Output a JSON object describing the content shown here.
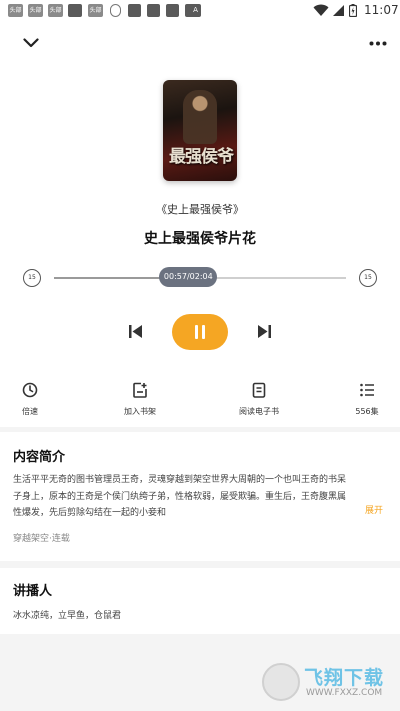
{
  "status_bar": {
    "time": "11:07",
    "notif_labels": [
      "头部",
      "头部",
      "头部",
      "头部"
    ],
    "a_label": "A"
  },
  "header": {
    "collapse_icon": "chevron-down-icon",
    "more_icon": "more-icon"
  },
  "cover": {
    "title_art": "最强侯爷"
  },
  "book_name": "《史上最强侯爷》",
  "episode_title": "史上最强侯爷片花",
  "player": {
    "time": "00:57/02:04",
    "progress": 0.46,
    "skip_back_label": "15",
    "skip_forward_label": "15"
  },
  "tools": [
    {
      "icon": "clock-icon",
      "label": "倍速"
    },
    {
      "icon": "add-shelf-icon",
      "label": "加入书架"
    },
    {
      "icon": "ebook-icon",
      "label": "阅读电子书"
    },
    {
      "icon": "list-icon",
      "label": "556集"
    }
  ],
  "intro": {
    "title": "内容简介",
    "line1": "生活平平无奇的图书管理员王奇，灵魂穿越到架空世界大周朝的一个也叫王奇的书呆",
    "line2": "子身上，原本的王奇是个侯门纨绔子弟，性格软弱，屡受欺骗。重生后，王奇腹黑属",
    "line3": "性爆发，先后剪除勾结在一起的小妾和",
    "expand": "展开",
    "tags": "穿越架空·连载"
  },
  "narrator": {
    "title": "讲播人",
    "names": "冰水凉纯，立早鱼，仓鼠君"
  },
  "watermark": {
    "text": "飞翔下载",
    "url": "WWW.FXXZ.COM"
  },
  "colors": {
    "accent": "#f5a623",
    "pill": "#6b7280",
    "background": "#f4f4f4"
  }
}
